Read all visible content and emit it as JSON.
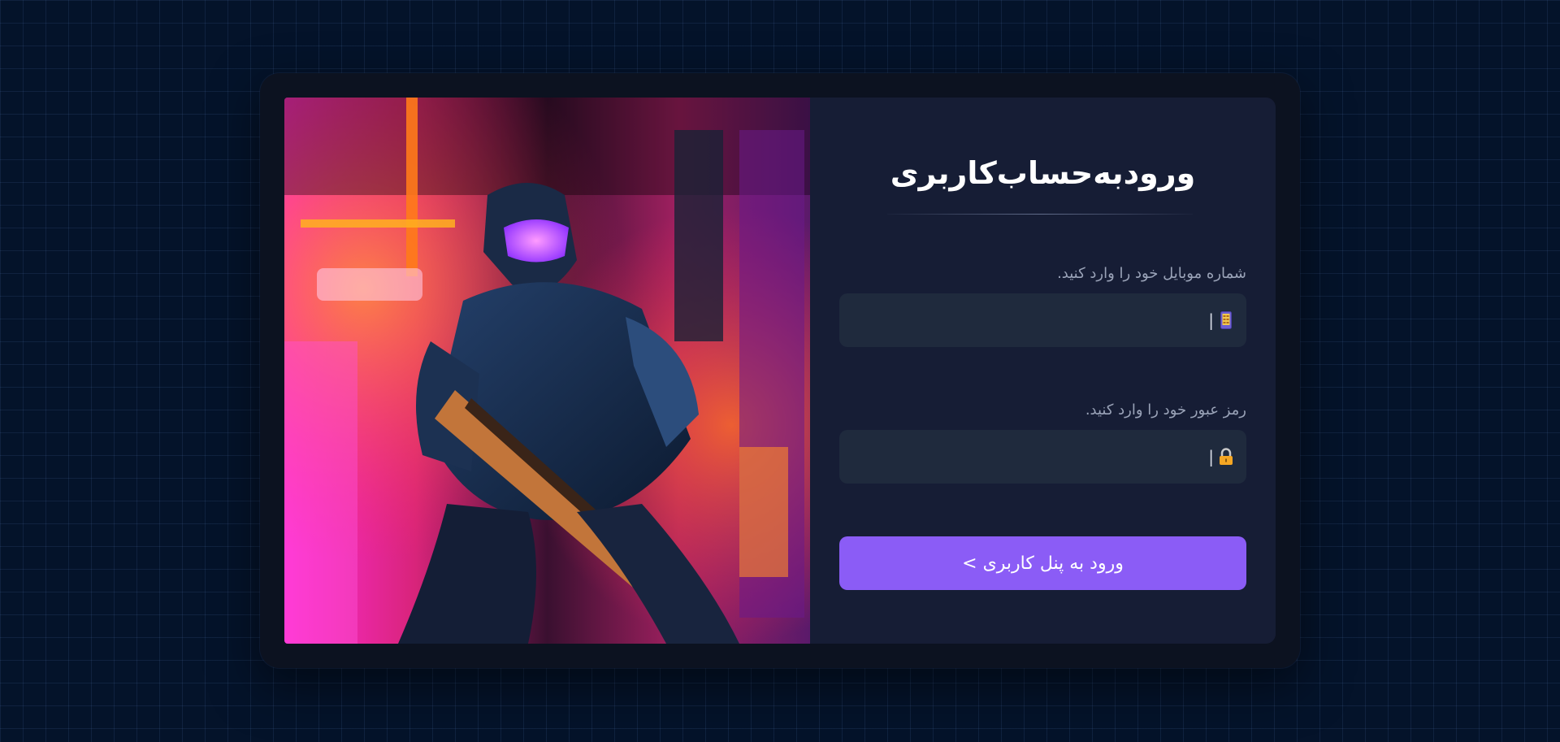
{
  "login": {
    "title": "ورودبه‌حساب‌کاربری",
    "phone": {
      "label": "شماره موبایل خود را وارد کنید.",
      "value": "",
      "placeholder": "",
      "icon": "mobile-phone-icon",
      "separator": "|"
    },
    "password": {
      "label": "رمز عبور خود را وارد کنید.",
      "value": "",
      "placeholder": "",
      "icon": "lock-icon",
      "separator": "|"
    },
    "submit_label": "ورود به پنل کاربری >"
  },
  "colors": {
    "background": "#04132a",
    "card": "#0c1220",
    "panel": "#161d35",
    "input": "#1f2a3d",
    "accent": "#8b5cf6",
    "label": "#9aa3b8"
  }
}
